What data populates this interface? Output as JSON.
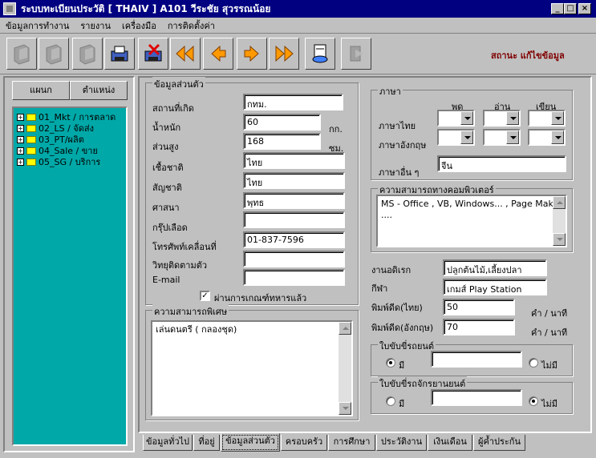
{
  "window": {
    "title": "ระบบทะเบียนประวัติ [ THAIV ]   A101   วีระชัย   สุวรรณน้อย",
    "min": "_",
    "max": "□",
    "close": "×"
  },
  "menu": [
    "ข้อมูลการทำงาน",
    "รายงาน",
    "เครื่องมือ",
    "การติดตั้งค่า"
  ],
  "toolbar": {
    "icons": [
      "computer-disabled-icon",
      "computer-disabled-icon",
      "computer-disabled-icon",
      "save-disk-icon",
      "delete-disk-icon",
      "first-record-icon",
      "previous-record-icon",
      "next-record-icon",
      "last-record-icon",
      "print-icon",
      "exit-disabled-icon"
    ]
  },
  "status": "สถานะ แก้ไขข้อมูล",
  "side": {
    "tab_dept": "แผนก",
    "tab_position": "ตำแหน่ง",
    "tree": [
      "01_Mkt / การตลาด",
      "02_LS / จัดส่ง",
      "03_PT/ผลิต",
      "04_Sale / ขาย",
      "05_SG / บริการ"
    ]
  },
  "personal": {
    "group_title": "ข้อมูลส่วนตัว",
    "birthplace_label": "สถานที่เกิด",
    "birthplace": "กทม.",
    "weight_label": "น้ำหนัก",
    "weight": "60",
    "weight_unit": "กก.",
    "height_label": "ส่วนสูง",
    "height": "168",
    "height_unit": "ซม.",
    "race_label": "เชื้อชาติ",
    "race": "ไทย",
    "nationality_label": "สัญชาติ",
    "nationality": "ไทย",
    "religion_label": "ศาสนา",
    "religion": "พุทธ",
    "blood_label": "กรุ๊ปเลือด",
    "blood": "",
    "mobile_label": "โทรศัพท์เคลื่อนที่",
    "mobile": "01-837-7596",
    "radio_label": "วิทยุติดตามตัว",
    "radio": "",
    "email_label": "E-mail",
    "email": "",
    "military_check": "✓",
    "military_label": "ผ่านการเกณฑ์ทหารแล้ว"
  },
  "special": {
    "group_title": "ความสามารถพิเศษ",
    "text": "เล่นดนตรี ( กลองชุด)"
  },
  "language": {
    "group_title": "ภาษา",
    "col_speak": "พูด",
    "col_read": "อ่าน",
    "col_write": "เขียน",
    "thai_label": "ภาษาไทย",
    "english_label": "ภาษาอังกฤษ",
    "other_label": "ภาษาอื่น ๆ",
    "other": "จีน"
  },
  "computer": {
    "group_title": "ความสามารถทางคอมพิวเตอร์",
    "text": "MS - Office , VB, Windows... , Page Maker ...."
  },
  "hobby_label": "งานอดิเรก",
  "hobby": "ปลูกต้นไม้,เลี้ยงปลา",
  "sport_label": "กีฬา",
  "sport": "เกมส์ Play Station",
  "typing_thai_label": "พิมพ์ดีด(ไทย)",
  "typing_thai": "50",
  "typing_thai_unit": "คำ / นาที",
  "typing_en_label": "พิมพ์ดีด(อังกฤษ)",
  "typing_en": "70",
  "typing_en_unit": "คำ / นาที",
  "car_license": {
    "group_title": "ใบขับขี่รถยนต์",
    "yes": "มี",
    "no": "ไม่มี",
    "value": ""
  },
  "moto_license": {
    "group_title": "ใบขับขี่รถจักรยานยนต์",
    "yes": "มี",
    "no": "ไม่มี",
    "value": ""
  },
  "tabs": [
    "ข้อมูลทั่วไป",
    "ที่อยู่",
    "ข้อมูลส่วนตัว",
    "ครอบครัว",
    "การศึกษา",
    "ประวัติงาน",
    "เงินเดือน",
    "ผู้ค้ำประกัน"
  ]
}
